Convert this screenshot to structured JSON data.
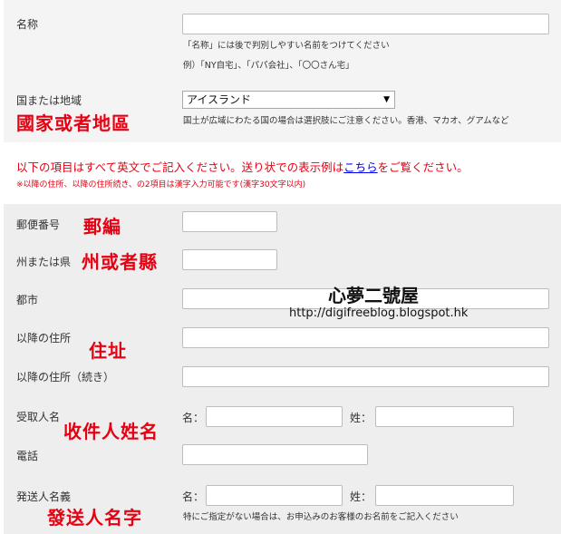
{
  "name": {
    "label": "名称",
    "value": "",
    "hint1": "「名称」には後で判別しやすい名前をつけてください",
    "hint2": "例）「NY自宅」、「パパ会社」、「〇〇さん宅」"
  },
  "country": {
    "label": "国または地域",
    "annotation": "國家或者地區",
    "selected": "アイスランド",
    "hint": "国土が広域にわたる国の場合は選択肢にご注意ください。香港、マカオ、グアムなど"
  },
  "notice": {
    "text_before": "以下の項目はすべて英文でご記入ください。送り状での表示例は",
    "link": "こちら",
    "text_after": "をご覧ください。",
    "sub": "※以降の住所、以降の住所続き、の2項目は漢字入力可能です(漢字30文字以内)"
  },
  "postal": {
    "label": "郵便番号",
    "annotation": "郵編",
    "value": ""
  },
  "state": {
    "label": "州または県",
    "annotation": "州或者縣",
    "value": ""
  },
  "city": {
    "label": "都市",
    "value": ""
  },
  "address1": {
    "label": "以降の住所",
    "annotation": "住址",
    "value": ""
  },
  "address2": {
    "label": "以降の住所（続き）",
    "value": ""
  },
  "recipient": {
    "label": "受取人名",
    "annotation": "收件人姓名",
    "first_label": "名：",
    "last_label": "姓：",
    "first_value": "",
    "last_value": ""
  },
  "phone": {
    "label": "電話",
    "value": ""
  },
  "sender": {
    "label": "発送人名義",
    "annotation": "發送人名字",
    "first_label": "名：",
    "last_label": "姓：",
    "first_value": "",
    "last_value": "",
    "hint": "特にご指定がない場合は、お申込みのお客様のお名前をご記入ください"
  },
  "watermark": {
    "title": "心夢二號屋",
    "url": "http://digifreeblog.blogspot.hk"
  },
  "colors": {
    "annotation": "#e60012",
    "link": "#0000ee",
    "panel_top": "#f4f4f4",
    "panel_bottom": "#eeeeee"
  }
}
